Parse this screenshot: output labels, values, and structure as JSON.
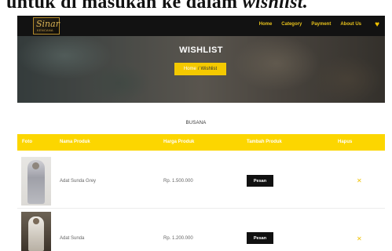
{
  "caption": {
    "text_start": "untuk di masukan ke dalam ",
    "text_italic": "wishlist."
  },
  "navbar": {
    "logo_script": "Sinar",
    "logo_sub": "KENCANA",
    "links": [
      "Home",
      "Category",
      "Payment",
      "About Us"
    ],
    "wishlist_icon": "heart-icon"
  },
  "hero": {
    "title": "WISHLIST",
    "breadcrumb_home": "Home",
    "breadcrumb_separator": "/",
    "breadcrumb_current": "Wishlist"
  },
  "category": "BUSANA",
  "table": {
    "headers": [
      "Foto",
      "Nama Produk",
      "Harga Produk",
      "Tambah Produk",
      "Hapus"
    ],
    "rows": [
      {
        "name": "Adat Sunda Grey",
        "price": "Rp. 1.500.000",
        "action_label": "Pesan",
        "remove_icon": "close-icon"
      },
      {
        "name": "Adat Sunda",
        "price": "Rp. 1.200.000",
        "action_label": "Pesan",
        "remove_icon": "close-icon"
      }
    ]
  },
  "colors": {
    "accent": "#fcd600",
    "navbar_bg": "#121212",
    "nav_link": "#e8c21b",
    "button_bg": "#111111"
  }
}
